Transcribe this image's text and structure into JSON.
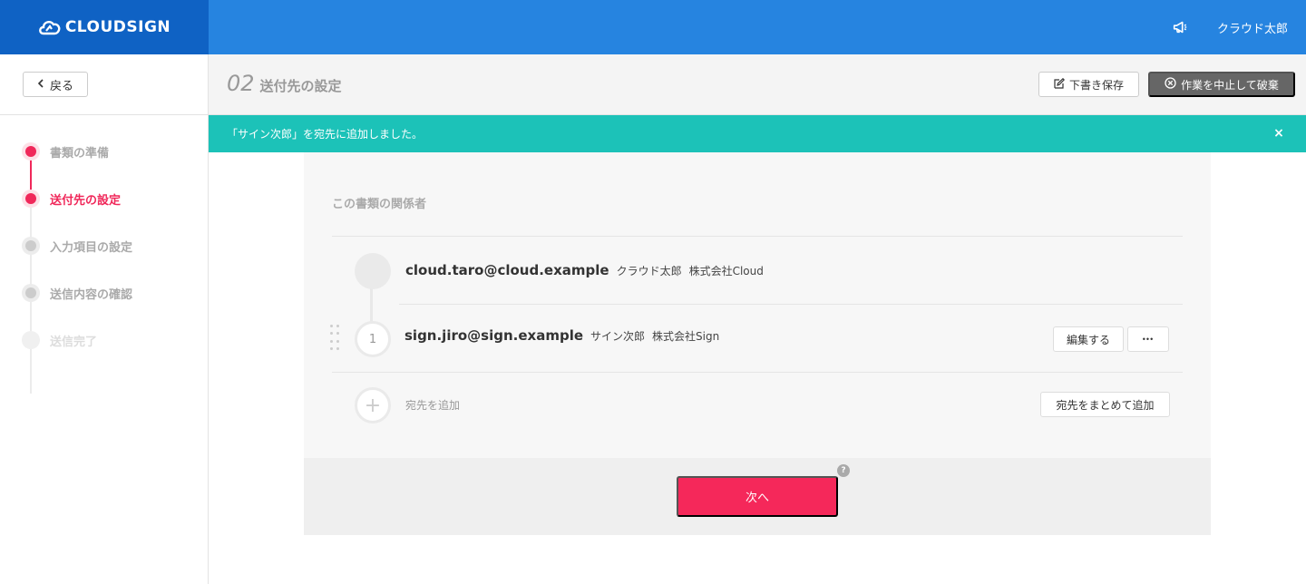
{
  "header": {
    "brand": "CLOUDSIGN",
    "user_name": "クラウド太郎",
    "notification_icon": "megaphone-icon"
  },
  "sidebar": {
    "back_label": "戻る",
    "steps": [
      {
        "label": "書類の準備",
        "state": "done"
      },
      {
        "label": "送付先の設定",
        "state": "current"
      },
      {
        "label": "入力項目の設定",
        "state": "todo"
      },
      {
        "label": "送信内容の確認",
        "state": "todo"
      },
      {
        "label": "送信完了",
        "state": "todo"
      }
    ]
  },
  "topbar": {
    "step_number": "02",
    "title": "送付先の設定",
    "draft_label": "下書き保存",
    "discard_label": "作業を中止して破棄"
  },
  "toast": {
    "message": "「サイン次郎」を宛先に追加しました。",
    "close_glyph": "×"
  },
  "main": {
    "section_title": "この書類の関係者",
    "sender": {
      "email": "cloud.taro@cloud.example",
      "name": "クラウド太郎",
      "company": "株式会社Cloud"
    },
    "recipients": [
      {
        "order": "1",
        "email": "sign.jiro@sign.example",
        "name": "サイン次郎",
        "company": "株式会社Sign",
        "edit_label": "編集する",
        "more_label": "•••"
      }
    ],
    "add_recipient_label": "宛先を追加",
    "bulk_add_label": "宛先をまとめて追加",
    "plus_glyph": "+",
    "next_label": "次へ",
    "help_glyph": "?"
  },
  "colors": {
    "header_blue": "#2684e0",
    "logo_blue": "#0f62c4",
    "accent_pink": "#f5285a",
    "toast_teal": "#1cc2b8"
  }
}
